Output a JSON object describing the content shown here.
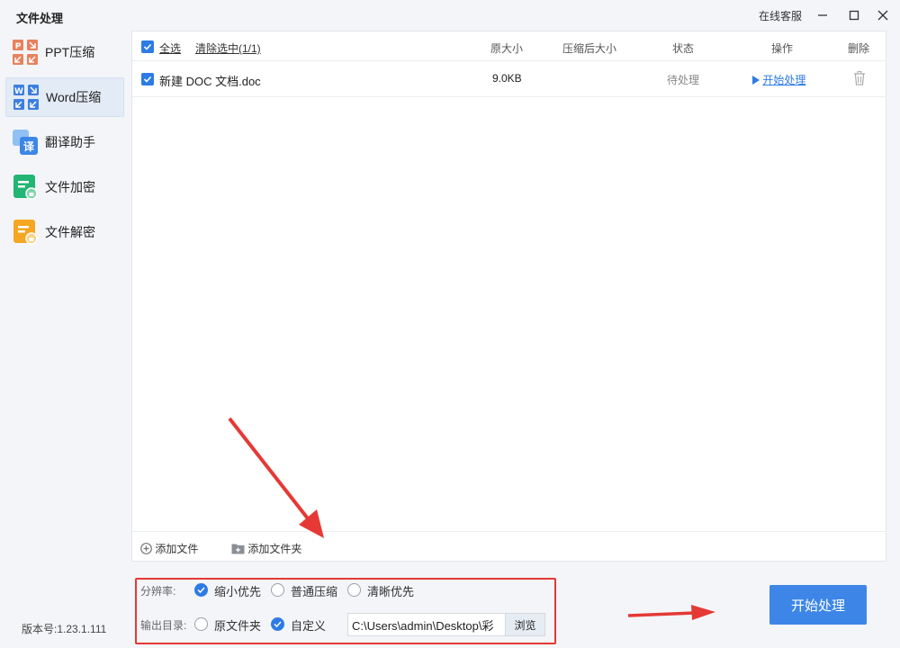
{
  "app": {
    "title": "文件处理",
    "service_label": "在线客服",
    "version_label": "版本号:1.23.1.111"
  },
  "sidebar": {
    "items": [
      {
        "label": "PPT压缩",
        "icon": "ppt-compress-icon",
        "active": false
      },
      {
        "label": "Word压缩",
        "icon": "word-compress-icon",
        "active": true
      },
      {
        "label": "翻译助手",
        "icon": "translate-icon",
        "active": false
      },
      {
        "label": "文件加密",
        "icon": "file-encrypt-icon",
        "active": false
      },
      {
        "label": "文件解密",
        "icon": "file-decrypt-icon",
        "active": false
      }
    ]
  },
  "table": {
    "select_all": "全选",
    "clear_selected": "清除选中(1/1)",
    "columns": {
      "original_size": "原大小",
      "compressed_size": "压缩后大小",
      "status": "状态",
      "action": "操作",
      "delete": "删除"
    },
    "rows": [
      {
        "name": "新建 DOC 文档.doc",
        "original_size": "9.0KB",
        "compressed_size": "",
        "status": "待处理",
        "action": "开始处理",
        "checked": true
      }
    ],
    "add_file": "添加文件",
    "add_folder": "添加文件夹"
  },
  "options": {
    "resolution_label": "分辨率:",
    "resolution_options": [
      "缩小优先",
      "普通压缩",
      "清晰优先"
    ],
    "resolution_selected": "缩小优先",
    "output_label": "输出目录:",
    "output_options": [
      "原文件夹",
      "自定义"
    ],
    "output_selected": "自定义",
    "output_path": "C:\\Users\\admin\\Desktop\\彩",
    "browse_label": "浏览"
  },
  "start_button": "开始处理",
  "colors": {
    "accent": "#2d7be5",
    "button": "#3d86e8",
    "annotation_red": "#e53935"
  }
}
